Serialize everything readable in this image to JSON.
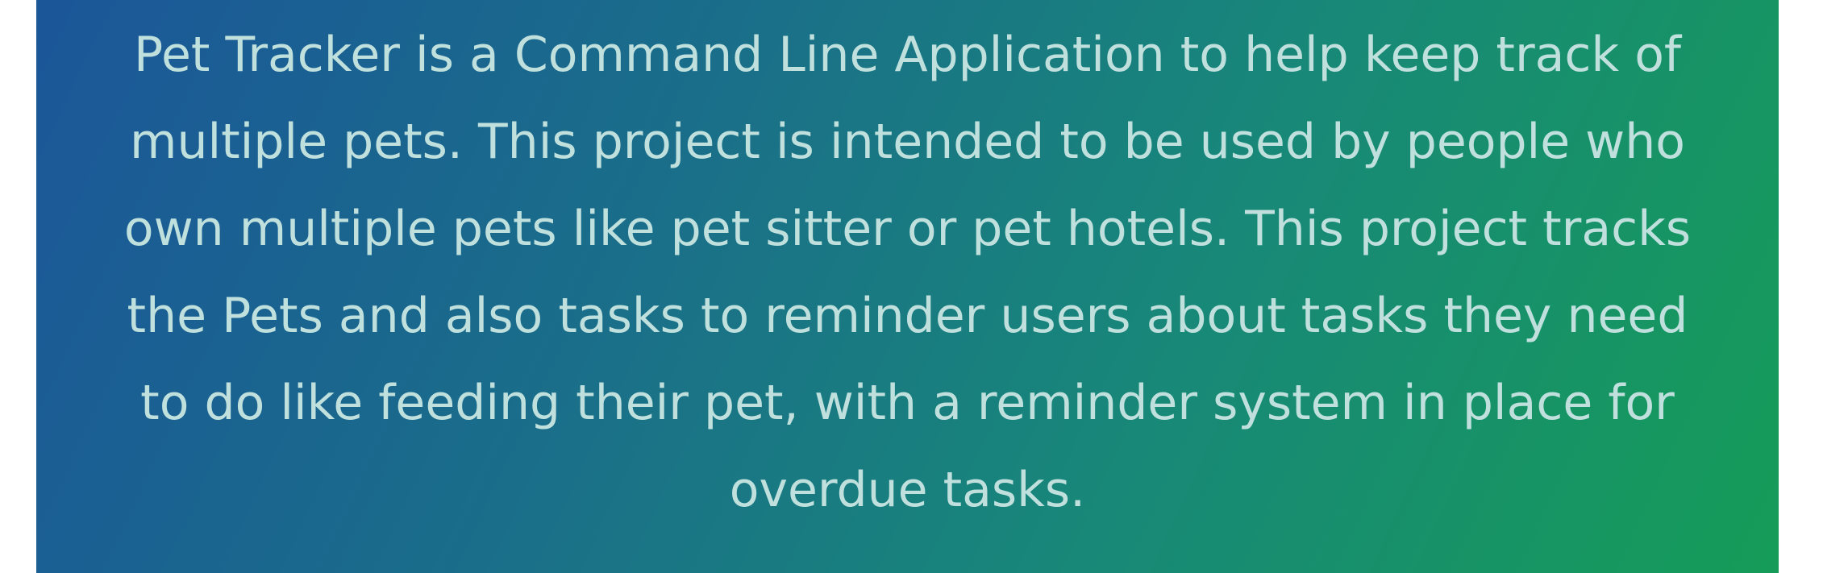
{
  "banner": {
    "lines": [
      "Pet Tracker is a Command Line Application to help keep track of",
      "multiple pets. This project is intended to be used by people who",
      "own multiple pets like pet sitter or pet hotels. This project tracks",
      "the Pets and also tasks to reminder users about tasks they need",
      "to do like feeding their pet, with a reminder system in place for",
      "overdue tasks."
    ],
    "colors": {
      "gradient_start": "#1b5699",
      "gradient_end": "#169c58",
      "text": "#bfe0dd"
    }
  }
}
